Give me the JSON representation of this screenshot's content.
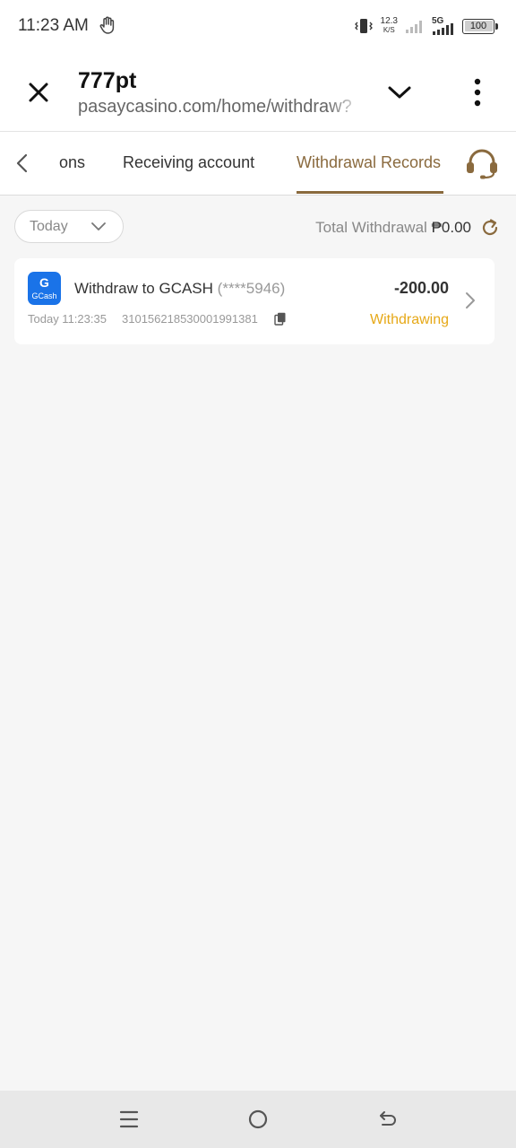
{
  "status_bar": {
    "time": "11:23 AM",
    "net_speed_value": "12.3",
    "net_speed_unit": "K/S",
    "network_type": "5G",
    "battery": "100"
  },
  "browser": {
    "title": "777pt",
    "url": "pasaycasino.com/home/withdraw?"
  },
  "tabs": {
    "partial_label": "ons",
    "receiving_label": "Receiving account",
    "records_label": "Withdrawal Records"
  },
  "filter": {
    "selected": "Today",
    "total_label": "Total Withdrawal",
    "total_amount": "₱0.00"
  },
  "records": [
    {
      "logo_text": "GCash",
      "title": "Withdraw to GCASH",
      "account_mask": "(****5946)",
      "amount": "-200.00",
      "time": "Today 11:23:35",
      "order_id": "310156218530001991381",
      "status": "Withdrawing"
    }
  ],
  "colors": {
    "accent": "#8a6a3e",
    "status_pending": "#e6a817",
    "gcash_blue": "#1a73e8"
  },
  "icons": [
    "hand-icon",
    "vibrate-icon",
    "signal-icon",
    "close-icon",
    "chevron-down-icon",
    "more-vertical-icon",
    "chevron-left-icon",
    "headset-icon",
    "refresh-icon",
    "copy-icon",
    "chevron-right-icon",
    "menu-icon",
    "home-icon",
    "back-icon"
  ]
}
